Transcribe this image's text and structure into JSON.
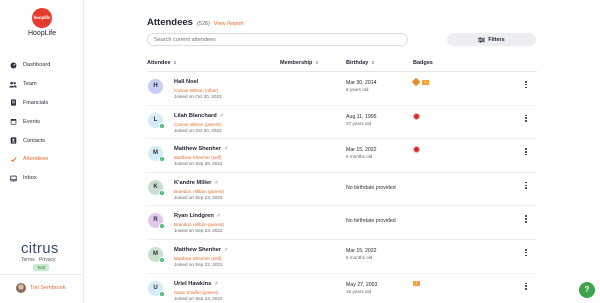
{
  "app": {
    "logo_text": "hooplife",
    "name": "HoopLife"
  },
  "sidebar": {
    "items": [
      {
        "label": "Dashboard",
        "icon": "dashboard-icon"
      },
      {
        "label": "Team",
        "icon": "team-icon"
      },
      {
        "label": "Financials",
        "icon": "financials-icon"
      },
      {
        "label": "Events",
        "icon": "events-icon"
      },
      {
        "label": "Contacts",
        "icon": "contacts-icon"
      },
      {
        "label": "Attendees",
        "icon": "attendees-icon",
        "active": true
      },
      {
        "label": "Inbox",
        "icon": "inbox-icon"
      }
    ],
    "brand": "citrus",
    "terms": "Terms",
    "privacy": "Privacy",
    "env_badge": "Test",
    "user_name": "Tori Sembrook"
  },
  "header": {
    "title": "Attendees",
    "count": "(528)",
    "report_link": "View Report",
    "search_placeholder": "Search current attendees",
    "filters_label": "Filters"
  },
  "table": {
    "columns": [
      "Attendee",
      "Membership",
      "Birthday",
      "Badges"
    ],
    "rows": [
      {
        "initial": "H",
        "avatar_color": "#c6cdf6",
        "name": "Hall Noel",
        "gender": "",
        "guardian": "Connie Wilson (other)",
        "joined": "Joined on Oct 20, 2022",
        "birthday": "Mar 30, 2014",
        "age": "8 years old",
        "verified": false,
        "badges": [
          "diamond",
          "tag"
        ],
        "tag_text": "1"
      },
      {
        "initial": "L",
        "avatar_color": "#d3ecf7",
        "name": "Lilah Blanchard",
        "gender": "♂",
        "guardian": "Connie Wilson (parent)",
        "joined": "Joined on Oct 20, 2022",
        "birthday": "Aug 11, 1995",
        "age": "27 years old",
        "verified": true,
        "badges": [
          "round"
        ]
      },
      {
        "initial": "M",
        "avatar_color": "#d3ecf7",
        "name": "Matthew Shenher",
        "gender": "♂",
        "guardian": "Matthew Shenher (self)",
        "joined": "Joined on Sep 28, 2022",
        "birthday": "Mar 15, 2022",
        "age": "6 months old",
        "verified": true,
        "badges": [
          "round"
        ]
      },
      {
        "initial": "K",
        "avatar_color": "#c9e0cf",
        "name": "K'andre Miller",
        "gender": "♂",
        "guardian": "Brandon Hillbon (parent)",
        "joined": "Joined on Sep 23, 2022",
        "birthday": "",
        "no_birthday": "No birthdate provided",
        "age": "",
        "verified": true,
        "badges": []
      },
      {
        "initial": "R",
        "avatar_color": "#e2c8ef",
        "name": "Ryan Lindgren",
        "gender": "♂",
        "guardian": "Brandon Hillbon (parent)",
        "joined": "Joined on Sep 23, 2022",
        "birthday": "",
        "no_birthday": "No birthdate provided",
        "age": "",
        "verified": true,
        "badges": []
      },
      {
        "initial": "M",
        "avatar_color": "#c9e0cf",
        "name": "Matthew Shenher",
        "gender": "♂",
        "guardian": "Matthew Shenher (self)",
        "joined": "Joined on Sep 23, 2022",
        "birthday": "Mar 15, 2022",
        "age": "6 months old",
        "verified": true,
        "badges": []
      },
      {
        "initial": "U",
        "avatar_color": "#d3ecf7",
        "name": "Uriel Hawkins",
        "gender": "♂",
        "guardian": "Isaac Shaffer (parent)",
        "joined": "Joined on Sep 23, 2022",
        "birthday": "May 27, 2003",
        "age": "18 years old",
        "verified": true,
        "badges": [
          "tag"
        ],
        "tag_text": "1"
      }
    ]
  },
  "help_label": "?"
}
